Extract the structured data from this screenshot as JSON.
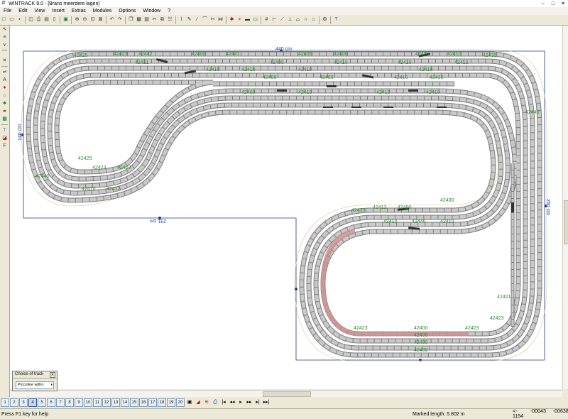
{
  "window": {
    "title": "WINTRACK 8.0 - [Brans meerdere lagen]",
    "app_icon": "wintrack-icon",
    "controls": [
      "minimize",
      "maximize",
      "close"
    ]
  },
  "menu": [
    "File",
    "Edit",
    "View",
    "Insert",
    "Extras",
    "Modules",
    "Options",
    "Window",
    "?"
  ],
  "toolbar_groups": [
    [
      "new-file-icon",
      "open-folder-icon",
      "save-icon"
    ],
    [
      "print-preview-icon",
      "print-icon",
      "print-setup-icon",
      "page-icon"
    ],
    [
      "layer-picture-icon"
    ],
    [
      "zoom-in-icon",
      "zoom-out-icon",
      "zoom-fit-icon",
      "zoom-window-icon"
    ],
    [
      "undo-icon",
      "redo-icon"
    ],
    [
      "copy-icon",
      "paste-icon",
      "delete-icon",
      "cut-icon",
      "clone-icon",
      "properties-icon"
    ],
    [
      "measure-icon",
      "pencil-icon",
      "track-connect-icon",
      "flex-track-icon",
      "scissors-icon",
      "snap-icon"
    ],
    [
      "rotate-icon",
      "mirror-icon",
      "align-icon"
    ],
    [
      "signal-icon",
      "catenary-icon",
      "train-icon",
      "wagon-icon"
    ],
    [
      "grid-icon",
      "ruler-icon",
      "gradient-icon",
      "height-icon",
      "bridge-icon",
      "tunnel-icon",
      "station-icon"
    ],
    [
      "options-icon"
    ],
    [
      "help-icon"
    ]
  ],
  "left_toolbar": [
    "select-icon",
    "tracks-icon",
    "points-icon",
    "curve-icon",
    "crossing-icon",
    "railroad-icon",
    "text-icon",
    "signal-icon",
    "building-icon",
    "tree-icon",
    "road-icon",
    "landscape-icon",
    "platform-icon",
    "rail-color-icon",
    "ruler-icon",
    "gradient-icon",
    "height-icon"
  ],
  "drawing": {
    "dimensions": {
      "top": "440 cm",
      "left": "140 cm",
      "right": "260 cm",
      "bottom": "231 cm"
    },
    "track_labels": [
      "42425",
      "42423",
      "42442",
      "42440",
      "42410",
      "42421",
      "42412",
      "42406",
      "42400",
      "42441",
      "42435",
      "42400",
      "42410",
      "42412",
      "42421",
      "42423"
    ]
  },
  "layers": {
    "buttons": [
      "1",
      "2",
      "3",
      "4",
      "5",
      "6",
      "7",
      "8",
      "9",
      "10",
      "11",
      "12",
      "13",
      "14",
      "15",
      "16",
      "17",
      "18",
      "19",
      "20"
    ],
    "active": "4"
  },
  "layer_tools": [
    "layer-view-icon",
    "eraser-icon",
    "train-run-icon",
    "print-layer-icon"
  ],
  "nav_buttons": [
    "first-icon",
    "prev-icon",
    "play-icon",
    "next-icon",
    "last-icon",
    "end-icon"
  ],
  "choice_of_track": {
    "title": "Choice of track",
    "selected": "Piccoline witho"
  },
  "status": {
    "help": "Press F1 key for help",
    "marked_length": "Marked length: 5.802 m",
    "x": "<- 1154",
    "y": "-00043",
    "z": "-00638"
  }
}
